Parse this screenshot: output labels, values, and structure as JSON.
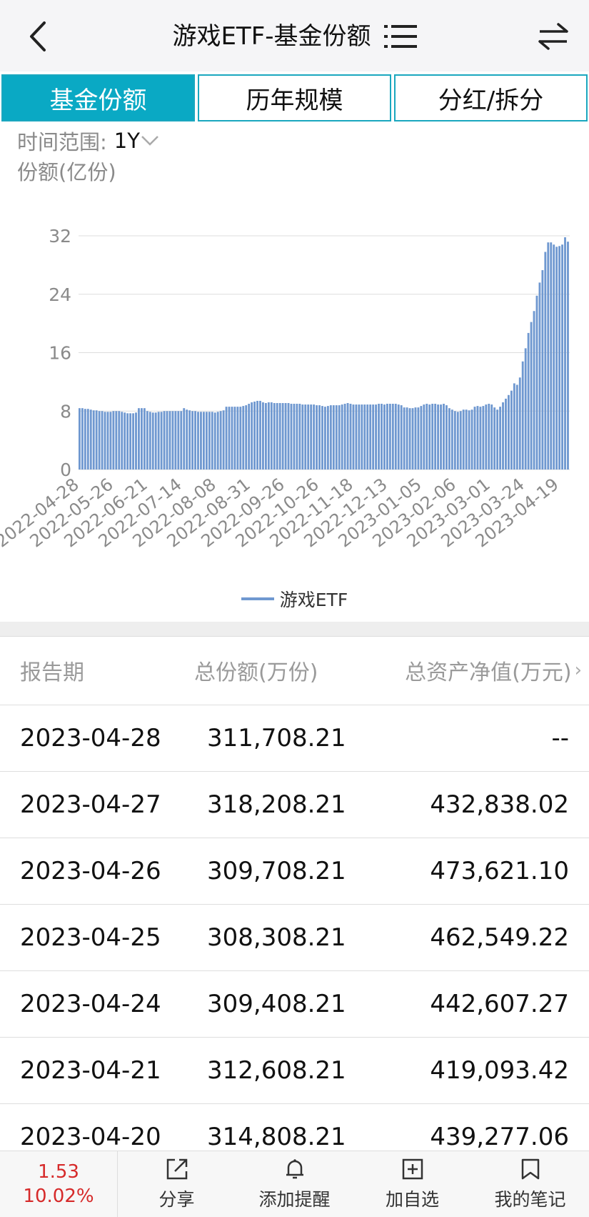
{
  "header": {
    "title": "游戏ETF-基金份额",
    "icons": [
      "back-icon",
      "menu-icon",
      "switch-icon"
    ]
  },
  "tabs": [
    {
      "label": "基金份额",
      "active": true
    },
    {
      "label": "历年规模",
      "active": false
    },
    {
      "label": "分红/拆分",
      "active": false
    }
  ],
  "filter": {
    "time_label": "时间范围:",
    "time_value": "1Y"
  },
  "unit_label": "份额(亿份)",
  "chart_data": {
    "type": "bar",
    "series": [
      {
        "name": "游戏ETF",
        "color": "#6f98d0"
      }
    ],
    "y_ticks": [
      "0",
      "8",
      "16",
      "24",
      "32"
    ],
    "ylim": [
      0,
      32
    ],
    "x_tick_labels": [
      "2022-04-28",
      "2022-05-26",
      "2022-06-21",
      "2022-07-14",
      "2022-08-08",
      "2022-08-31",
      "2022-09-26",
      "2022-10-26",
      "2022-11-18",
      "2022-12-13",
      "2023-01-05",
      "2023-02-06",
      "2023-03-01",
      "2023-03-24",
      "2023-04-19"
    ],
    "values": [
      8.4,
      8.4,
      8.3,
      8.3,
      8.2,
      8.1,
      8.1,
      8.0,
      8.0,
      7.9,
      7.9,
      7.9,
      8.0,
      8.0,
      8.0,
      7.9,
      7.8,
      7.7,
      7.7,
      7.7,
      7.8,
      8.4,
      8.4,
      8.4,
      8.0,
      7.9,
      7.8,
      7.8,
      7.9,
      7.9,
      8.0,
      8.0,
      8.0,
      8.0,
      8.0,
      8.0,
      8.0,
      8.4,
      8.2,
      8.1,
      8.0,
      8.0,
      7.9,
      7.9,
      7.9,
      7.9,
      7.9,
      7.9,
      7.8,
      7.9,
      8.0,
      8.1,
      8.6,
      8.6,
      8.6,
      8.6,
      8.6,
      8.6,
      8.7,
      8.8,
      9.0,
      9.2,
      9.3,
      9.4,
      9.4,
      9.2,
      9.1,
      9.2,
      9.2,
      9.1,
      9.1,
      9.1,
      9.1,
      9.1,
      9.1,
      9.0,
      9.0,
      9.0,
      9.0,
      8.9,
      8.9,
      8.9,
      8.9,
      8.9,
      8.8,
      8.8,
      8.7,
      8.6,
      8.7,
      8.8,
      8.8,
      8.8,
      8.8,
      8.9,
      9.0,
      9.1,
      9.0,
      8.9,
      8.9,
      8.9,
      8.9,
      8.9,
      8.9,
      8.9,
      8.9,
      8.9,
      9.0,
      9.0,
      8.9,
      9.0,
      9.0,
      9.0,
      9.0,
      8.9,
      8.8,
      8.5,
      8.5,
      8.4,
      8.4,
      8.5,
      8.5,
      8.7,
      8.9,
      9.0,
      8.9,
      9.0,
      9.0,
      8.9,
      8.9,
      9.0,
      8.8,
      8.4,
      8.2,
      8.0,
      7.9,
      8.0,
      8.2,
      8.2,
      8.1,
      8.2,
      8.6,
      8.7,
      8.6,
      8.7,
      8.9,
      9.0,
      8.9,
      8.5,
      8.2,
      8.6,
      9.2,
      9.7,
      10.2,
      10.8,
      11.8,
      11.6,
      12.6,
      14.8,
      16.6,
      18.7,
      20.2,
      21.7,
      23.8,
      25.6,
      27.3,
      29.8,
      31.1,
      31.1,
      30.8,
      30.5,
      30.6,
      30.8,
      31.8,
      31.2
    ]
  },
  "table": {
    "headers": [
      "报告期",
      "总份额(万份)",
      "总资产净值(万元)"
    ],
    "header_chevron": "›",
    "rows": [
      [
        "2023-04-28",
        "311,708.21",
        "--"
      ],
      [
        "2023-04-27",
        "318,208.21",
        "432,838.02"
      ],
      [
        "2023-04-26",
        "309,708.21",
        "473,621.10"
      ],
      [
        "2023-04-25",
        "308,308.21",
        "462,549.22"
      ],
      [
        "2023-04-24",
        "309,408.21",
        "442,607.27"
      ],
      [
        "2023-04-21",
        "312,608.21",
        "419,093.42"
      ],
      [
        "2023-04-20",
        "314,808.21",
        "439,277.06"
      ]
    ]
  },
  "bottom_bar": {
    "price": "1.53",
    "change": "10.02%",
    "price_color": "#d62a2a",
    "items": [
      {
        "label": "分享",
        "icon": "share-icon"
      },
      {
        "label": "添加提醒",
        "icon": "bell-icon"
      },
      {
        "label": "加自选",
        "icon": "add-watchlist-icon"
      },
      {
        "label": "我的笔记",
        "icon": "note-icon"
      }
    ]
  },
  "colors": {
    "accent": "#0aa9c4",
    "bar": "#6f98d0"
  }
}
